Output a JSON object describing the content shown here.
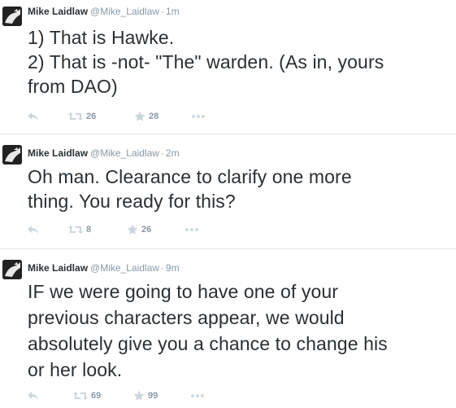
{
  "tweets": [
    {
      "name": "Mike Laidlaw",
      "handle": "@Mike_Laidlaw",
      "separator": "·",
      "time": "1m",
      "lines": [
        "1) That is Hawke.",
        "2) That is -not- \"The\" warden. (As in, yours",
        "from DAO)"
      ],
      "retweets": "26",
      "favorites": "28"
    },
    {
      "name": "Mike Laidlaw",
      "handle": "@Mike_Laidlaw",
      "separator": "·",
      "time": "2m",
      "lines": [
        "Oh man. Clearance to clarify one more",
        "thing. You ready for this?"
      ],
      "retweets": "8",
      "favorites": "26"
    },
    {
      "name": "Mike Laidlaw",
      "handle": "@Mike_Laidlaw",
      "separator": "·",
      "time": "9m",
      "lines": [
        "IF we were going to have one of your",
        "previous characters appear, we would",
        "absolutely give you a chance to change his",
        "or her look."
      ],
      "retweets": "69",
      "favorites": "99"
    }
  ],
  "icons": {
    "reply": "reply-icon",
    "retweet": "retweet-icon",
    "favorite": "star-icon",
    "more": "more-icon"
  },
  "colors": {
    "text": "#292f33",
    "muted": "#8899a6",
    "icon": "#ccd6dd",
    "separator": "#e1e8ed"
  }
}
